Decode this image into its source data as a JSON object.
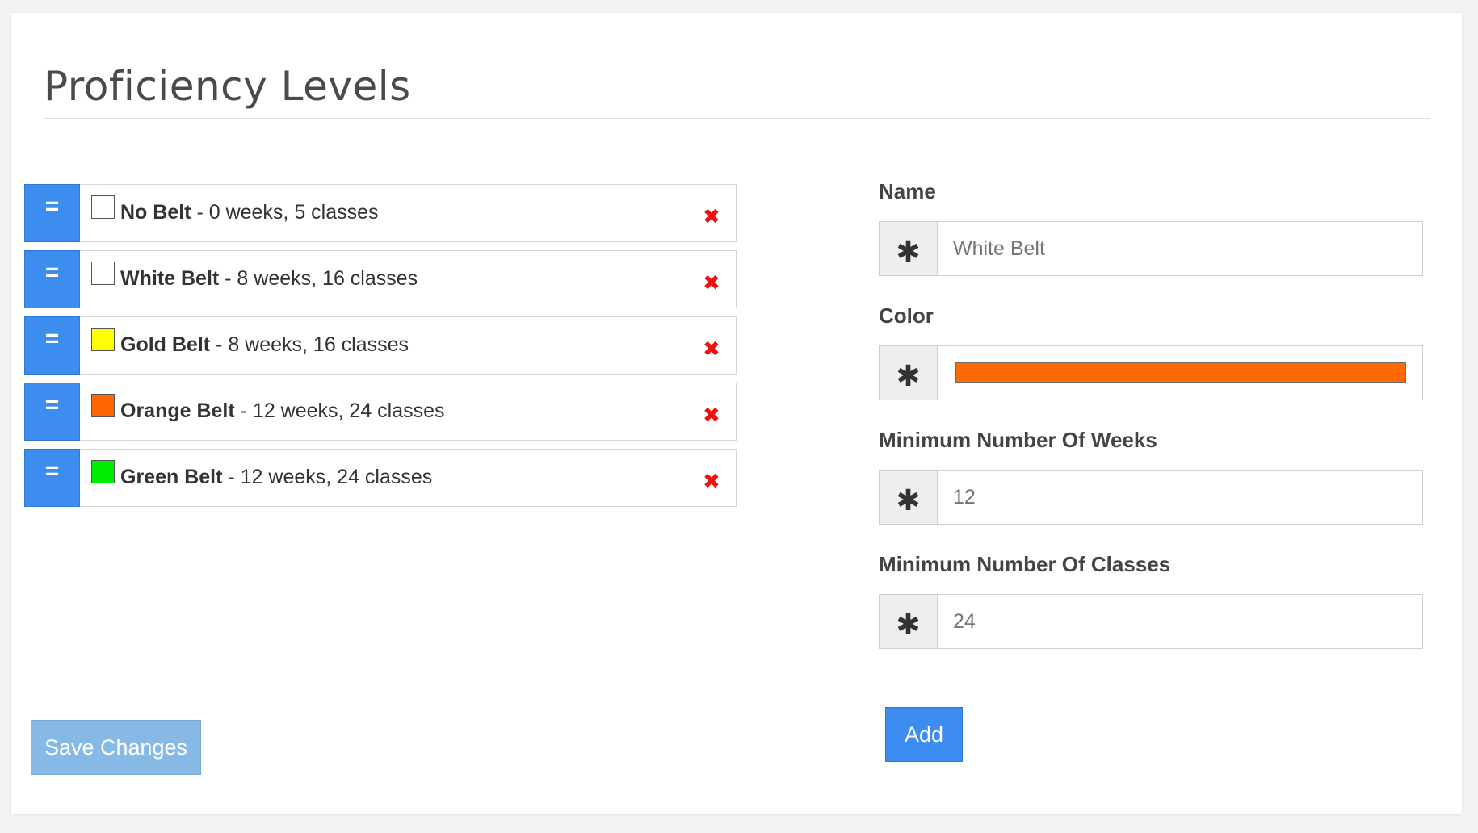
{
  "page": {
    "title": "Proficiency Levels"
  },
  "levels": [
    {
      "name": "No Belt",
      "detail": " - 0 weeks, 5 classes",
      "color": "#ffffff",
      "handle": "=",
      "remove": "✖"
    },
    {
      "name": "White Belt",
      "detail": " - 8 weeks, 16 classes",
      "color": "#ffffff",
      "handle": "=",
      "remove": "✖"
    },
    {
      "name": "Gold Belt",
      "detail": " - 8 weeks, 16 classes",
      "color": "#ffff00",
      "handle": "=",
      "remove": "✖"
    },
    {
      "name": "Orange Belt",
      "detail": " - 12 weeks, 24 classes",
      "color": "#ff6600",
      "handle": "=",
      "remove": "✖"
    },
    {
      "name": "Green Belt",
      "detail": " - 12 weeks, 24 classes",
      "color": "#00ee00",
      "handle": "=",
      "remove": "✖"
    }
  ],
  "actions": {
    "save_label": "Save Changes",
    "add_label": "Add"
  },
  "form": {
    "required_icon": "✱",
    "name": {
      "label": "Name",
      "placeholder": "White Belt"
    },
    "color": {
      "label": "Color",
      "value": "#ff6a00"
    },
    "min_weeks": {
      "label": "Minimum Number Of Weeks",
      "placeholder": "12"
    },
    "min_classes": {
      "label": "Minimum Number Of Classes",
      "placeholder": "24"
    }
  },
  "colors": {
    "primary": "#3d8cf0",
    "primary_disabled": "#86b9e6",
    "danger": "#ee1111"
  }
}
